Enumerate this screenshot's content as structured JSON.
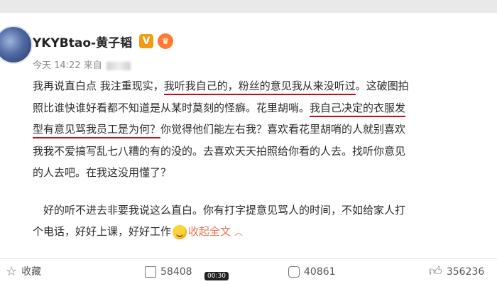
{
  "post": {
    "username": "YKYBtao-黄子韬",
    "v_badge": "V",
    "meta": "今天 14:22 来自",
    "lines": [
      {
        "a": "我再说直白点 我注重现实，",
        "hl": "我听我自己的，粉丝的意见我从来没听过",
        "b": "。这破图拍"
      },
      {
        "a": "照比谁快谁好看都不知道是从某时莫刻的怪癖。花里胡哨。",
        "hl": "我自己决定的衣服发",
        "b": ""
      },
      {
        "a": "",
        "hl": "型有意见骂我员工是为何？",
        "b": "你觉得他们能左右我？喜欢看花里胡哨的人就别喜欢"
      },
      {
        "a": "我我不爱搞写乱七八糟的有的没的。去喜欢天天拍照给你看的人去。找听你意见"
      },
      {
        "a": "的人去吧。在我这没用懂了？"
      }
    ],
    "para2": {
      "line1": "好的听不进去非要我说这么直白。你有打字提意见骂人的时间，不如给家人打",
      "line2_a": "个电话，好好上课，好好工作",
      "collapse_label": "收起全文",
      "caret": "︿"
    }
  },
  "actions": {
    "favorite_label": "收藏",
    "repost_count": "58408",
    "comment_count": "40861",
    "like_count": "356236"
  },
  "video_time": "00:30",
  "colors": {
    "highlight": "#c5091f",
    "link": "#eb7350",
    "vip": "#f39c12"
  }
}
